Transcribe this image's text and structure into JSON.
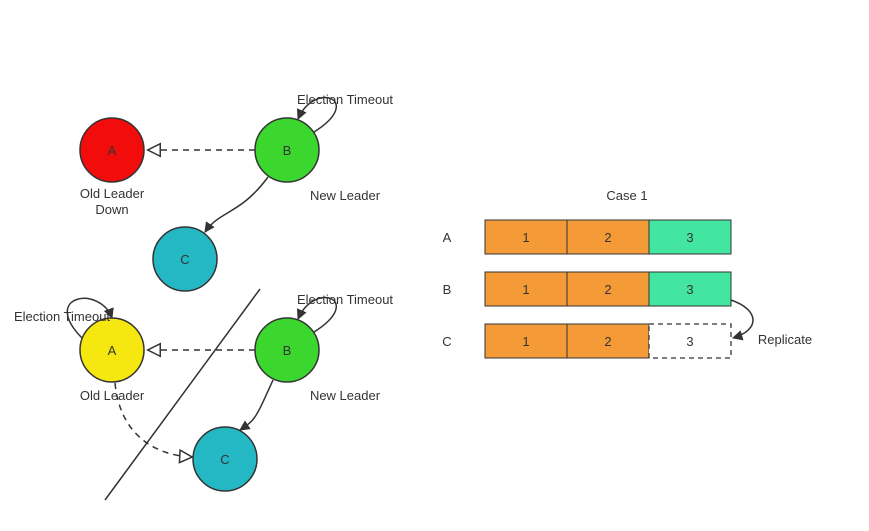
{
  "colors": {
    "red": "#f20c0c",
    "green": "#3bd62e",
    "teal": "#23b8c4",
    "yellow": "#f6e711",
    "orange": "#f49b38",
    "mint": "#43e6a1",
    "stroke": "#333333"
  },
  "top": {
    "A": {
      "letter": "A",
      "label1": "Old Leader",
      "label2": "Down"
    },
    "B": {
      "letter": "B",
      "label": "New Leader",
      "timeout": "Election Timeout"
    },
    "C": {
      "letter": "C"
    }
  },
  "bottom": {
    "A": {
      "letter": "A",
      "label": "Old Leader",
      "timeout": "Election Timeout"
    },
    "B": {
      "letter": "B",
      "label": "New Leader",
      "timeout": "Election Timeout"
    },
    "C": {
      "letter": "C"
    }
  },
  "logs": {
    "title": "Case 1",
    "rows": [
      {
        "id": "A",
        "cells": [
          {
            "v": "1",
            "c": "orange"
          },
          {
            "v": "2",
            "c": "orange"
          },
          {
            "v": "3",
            "c": "mint"
          }
        ]
      },
      {
        "id": "B",
        "cells": [
          {
            "v": "1",
            "c": "orange"
          },
          {
            "v": "2",
            "c": "orange"
          },
          {
            "v": "3",
            "c": "mint"
          }
        ]
      },
      {
        "id": "C",
        "cells": [
          {
            "v": "1",
            "c": "orange"
          },
          {
            "v": "2",
            "c": "orange"
          },
          {
            "v": "3",
            "c": "dashed"
          }
        ]
      }
    ],
    "replicate": "Replicate"
  }
}
